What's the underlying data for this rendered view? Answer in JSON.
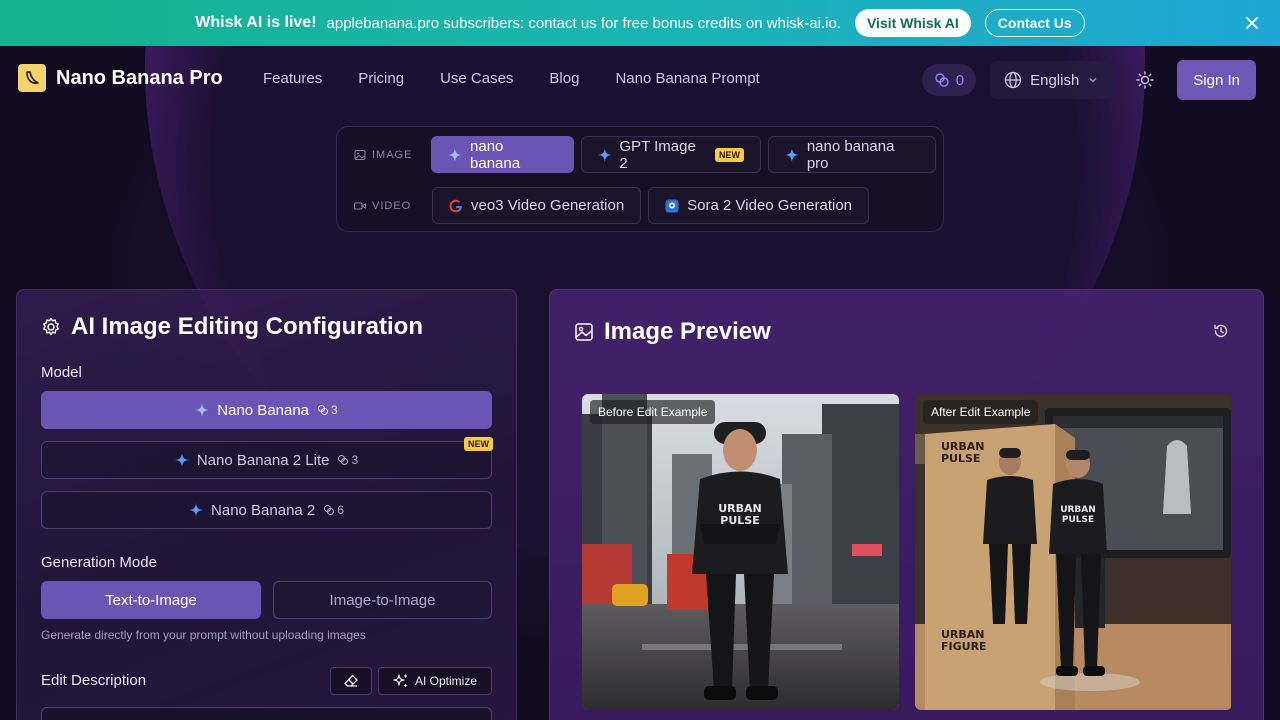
{
  "banner": {
    "title": "Whisk AI is live!",
    "message": "applebanana.pro subscribers: contact us for free bonus credits on whisk-ai.io.",
    "visit_label": "Visit Whisk AI",
    "contact_label": "Contact Us"
  },
  "nav": {
    "brand": "Nano Banana Pro",
    "links": [
      "Features",
      "Pricing",
      "Use Cases",
      "Blog",
      "Nano Banana Prompt"
    ],
    "credits": "0",
    "language": "English",
    "signin_label": "Sign In"
  },
  "switcher": {
    "image_label": "IMAGE",
    "video_label": "VIDEO",
    "image_models": [
      {
        "label": "nano banana",
        "active": true
      },
      {
        "label": "GPT Image 2",
        "badge": "NEW"
      },
      {
        "label": "nano banana pro"
      }
    ],
    "video_models": [
      {
        "label": "veo3 Video Generation"
      },
      {
        "label": "Sora 2 Video Generation"
      }
    ]
  },
  "config": {
    "title": "AI Image Editing Configuration",
    "model_label": "Model",
    "models": [
      {
        "label": "Nano Banana",
        "cost": "3",
        "active": true
      },
      {
        "label": "Nano Banana 2 Lite",
        "cost": "3",
        "badge": "NEW"
      },
      {
        "label": "Nano Banana 2",
        "cost": "6"
      }
    ],
    "mode_label": "Generation Mode",
    "mode_active": "Text-to-Image",
    "mode_inactive": "Image-to-Image",
    "mode_hint": "Generate directly from your prompt without uploading images",
    "edit_label": "Edit Description",
    "optimize_label": "AI Optimize"
  },
  "preview": {
    "title": "Image Preview",
    "before_label": "Before Edit Example",
    "after_label": "After Edit Example"
  },
  "colors": {
    "accent": "#6a55b5",
    "banner_start": "#13b38c",
    "banner_end": "#1fa6d6",
    "badge": "#f7c948"
  }
}
